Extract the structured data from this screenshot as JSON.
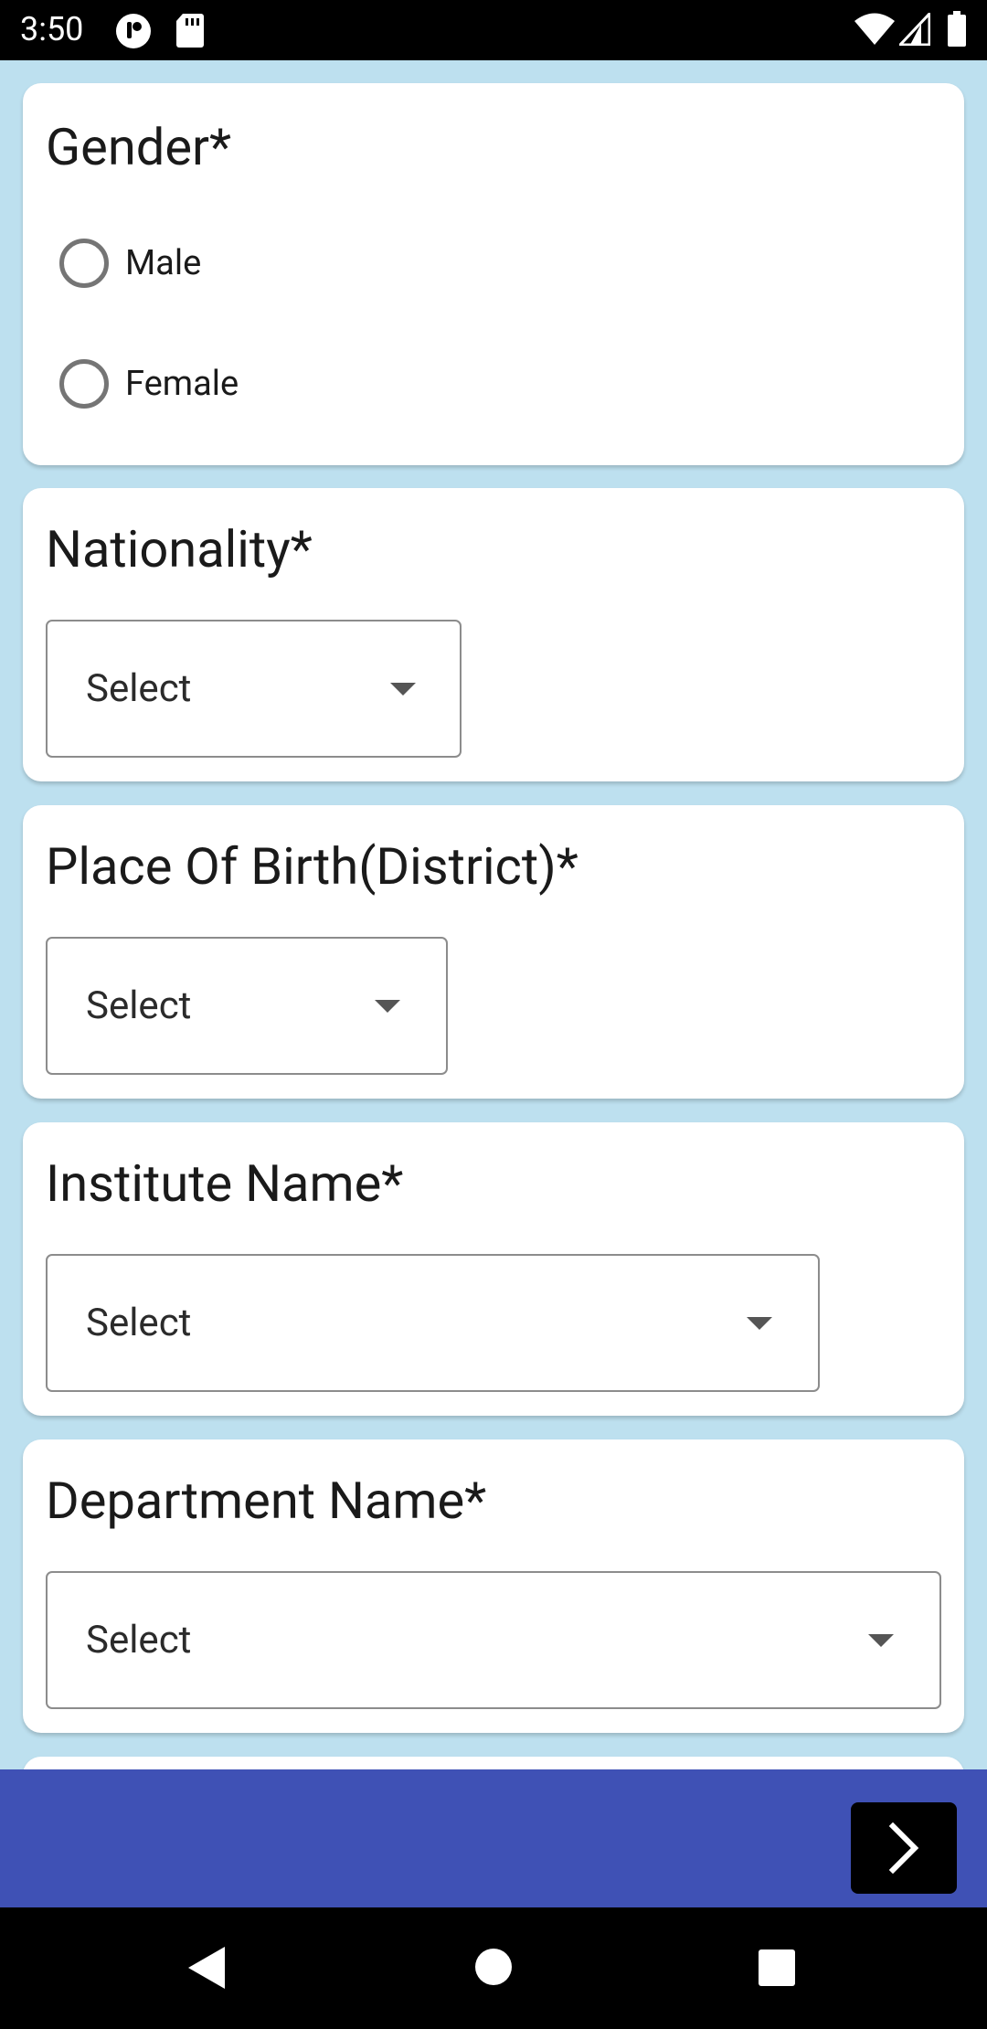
{
  "status_bar": {
    "time": "3:50",
    "icons": [
      "notification-app-icon",
      "sd-card-icon",
      "wifi-icon",
      "signal-icon",
      "battery-icon"
    ]
  },
  "form": {
    "gender": {
      "label": "Gender*",
      "options": [
        "Male",
        "Female"
      ],
      "selected": null
    },
    "nationality": {
      "label": "Nationality*",
      "value": "Select"
    },
    "place_of_birth": {
      "label": "Place Of Birth(District)*",
      "value": "Select"
    },
    "institute": {
      "label": "Institute Name*",
      "value": "Select"
    },
    "department": {
      "label": "Department Name*",
      "value": "Select"
    }
  },
  "bottom_bar": {
    "next_icon": "chevron-right-icon",
    "color": "#3f51b5"
  },
  "nav_bar": {
    "icons": [
      "back-icon",
      "home-icon",
      "recents-icon"
    ]
  },
  "colors": {
    "page_background": "#bde0ef",
    "card_background": "#ffffff",
    "accent": "#3f51b5"
  }
}
